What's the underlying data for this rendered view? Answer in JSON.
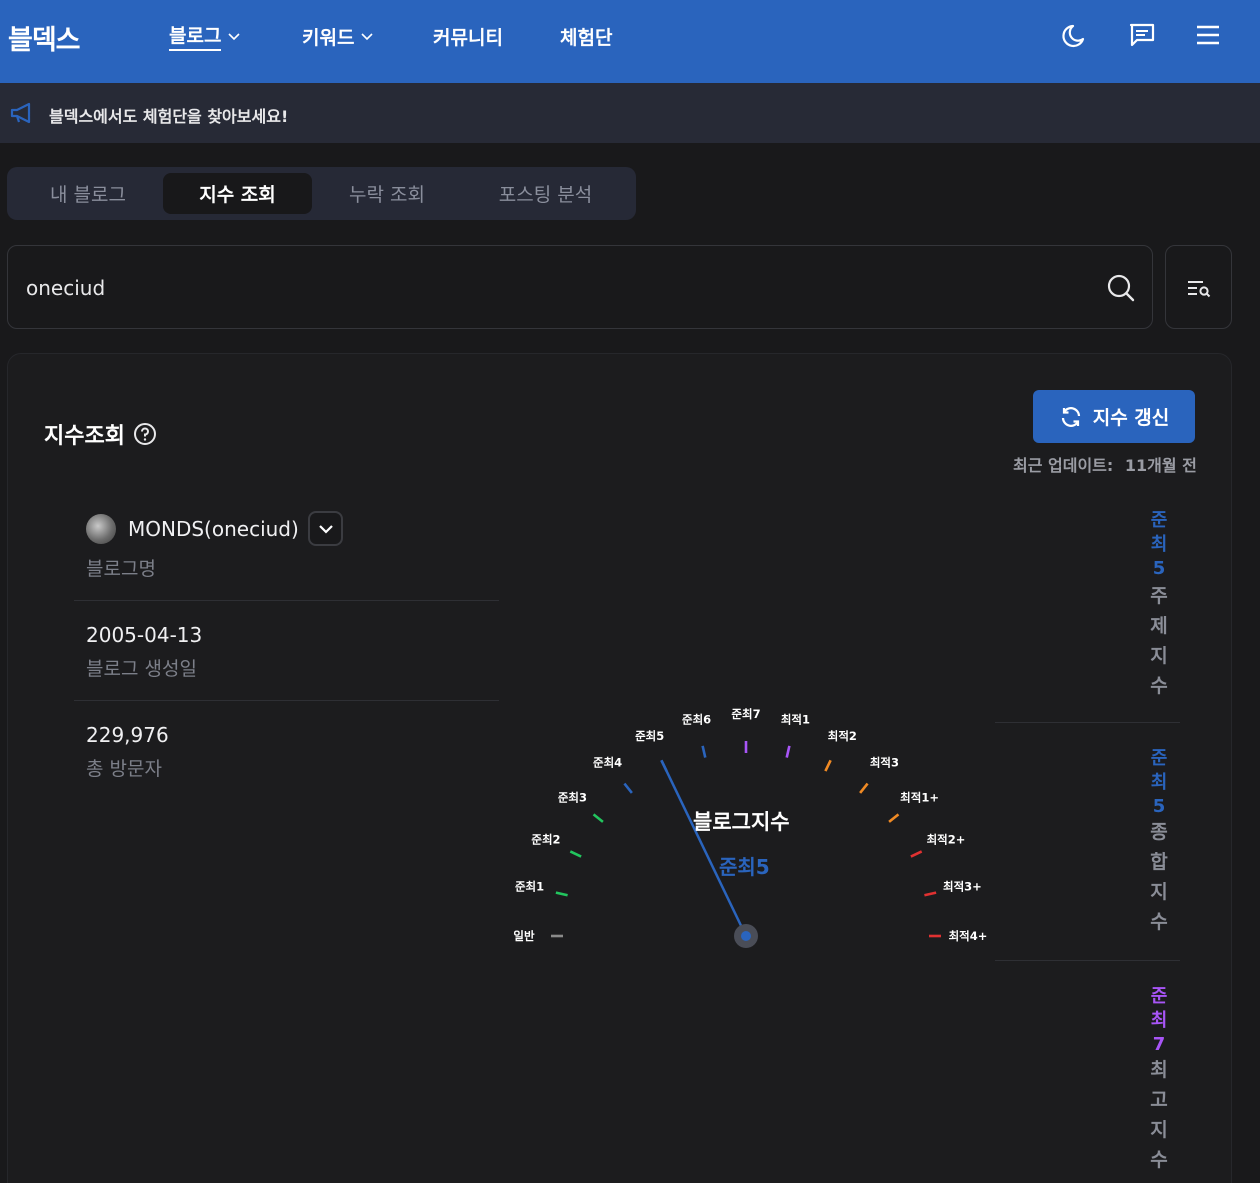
{
  "brand": {
    "logo": "블덱스",
    "accent": "#2a64bd"
  },
  "nav": {
    "items": [
      {
        "label": "블로그",
        "has_dropdown": true,
        "active": true
      },
      {
        "label": "키워드",
        "has_dropdown": true,
        "active": false
      },
      {
        "label": "커뮤니티",
        "has_dropdown": false,
        "active": false
      },
      {
        "label": "체험단",
        "has_dropdown": false,
        "active": false
      }
    ],
    "icons": [
      "moon-icon",
      "chat-icon",
      "menu-icon"
    ]
  },
  "announcement": {
    "icon": "megaphone-icon",
    "text": "블덱스에서도 체험단을 찾아보세요!"
  },
  "tabs": [
    {
      "label": "내 블로그",
      "active": false
    },
    {
      "label": "지수 조회",
      "active": true
    },
    {
      "label": "누락 조회",
      "active": false
    },
    {
      "label": "포스팅 분석",
      "active": false
    }
  ],
  "search": {
    "value": "oneciud",
    "icon": "search-icon",
    "filter_icon": "list-search-icon"
  },
  "card": {
    "title": "지수조회",
    "help_icon": "question-circle-icon",
    "refresh_label": "지수 갱신",
    "updated_label": "최근 업데이트:",
    "updated_value": "11개월 전"
  },
  "blog_info": {
    "name": "MONDS(oneciud)",
    "name_label": "블로그명",
    "created": "2005-04-13",
    "created_label": "블로그 생성일",
    "visitors": "229,976",
    "visitors_label": "총 방문자"
  },
  "gauge": {
    "title": "블로그지수",
    "value": "준최5",
    "labels": [
      "일반",
      "준최1",
      "준최2",
      "준최3",
      "준최4",
      "준최5",
      "준최6",
      "준최7",
      "최적1",
      "최적2",
      "최적3",
      "최적1+",
      "최적2+",
      "최적3+",
      "최적4+"
    ],
    "tick_colors": [
      "#8a8a8a",
      "#22c55e",
      "#22c55e",
      "#22c55e",
      "#2a64bd",
      "#2a64bd",
      "#2a64bd",
      "#a855f7",
      "#a855f7",
      "#f08a24",
      "#f08a24",
      "#f08a24",
      "#e03131",
      "#e03131",
      "#e03131"
    ],
    "needle_index": 5
  },
  "metrics": [
    {
      "grade": "준최5",
      "grade_color": "#2a64bd",
      "label": "주제지수"
    },
    {
      "grade": "준최5",
      "grade_color": "#2a64bd",
      "label": "종합지수"
    },
    {
      "grade": "준최7",
      "grade_color": "#a855f7",
      "label": "최고지수"
    }
  ]
}
